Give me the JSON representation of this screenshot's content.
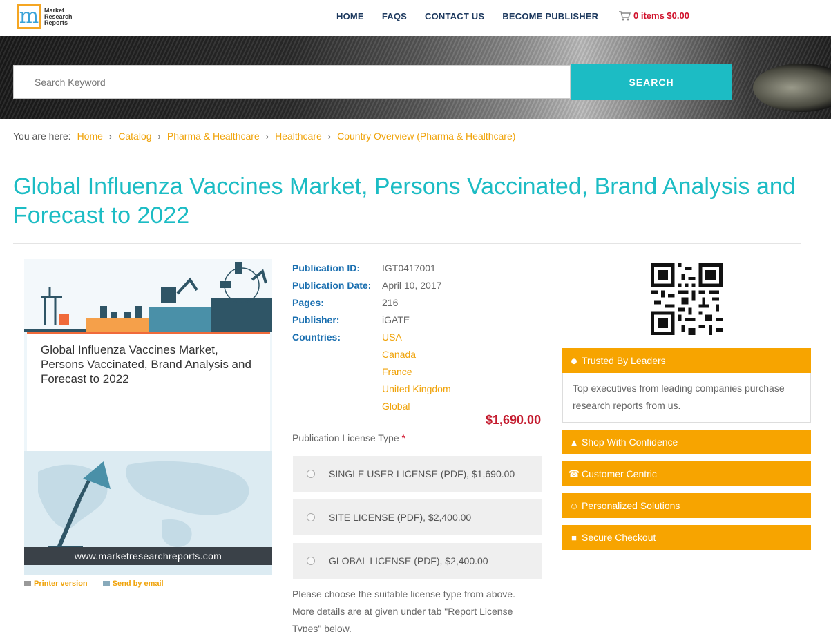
{
  "header": {
    "logo_lines": [
      "Market",
      "Research",
      "Reports"
    ],
    "nav": [
      "HOME",
      "FAQS",
      "CONTACT US",
      "BECOME PUBLISHER"
    ],
    "cart_text": "0 items $0.00"
  },
  "search": {
    "placeholder": "Search Keyword",
    "button_label": "SEARCH"
  },
  "breadcrumb": {
    "prefix": "You are here:",
    "items": [
      "Home",
      "Catalog",
      "Pharma & Healthcare",
      "Healthcare",
      "Country Overview (Pharma & Healthcare)"
    ]
  },
  "page_title": "Global Influenza Vaccines Market, Persons Vaccinated, Brand Analysis and Forecast to 2022",
  "cover": {
    "title": "Global Influenza Vaccines Market, Persons Vaccinated, Brand Analysis and Forecast to 2022",
    "url": "www.marketresearchreports.com",
    "printer_label": "Printer version",
    "email_label": "Send by email"
  },
  "meta": {
    "publication_id_label": "Publication ID:",
    "publication_id": "IGT0417001",
    "publication_date_label": "Publication Date:",
    "publication_date": "April 10, 2017",
    "pages_label": "Pages:",
    "pages": "216",
    "publisher_label": "Publisher:",
    "publisher": "iGATE",
    "countries_label": "Countries:",
    "countries": [
      "USA",
      "Canada",
      "France",
      "United Kingdom",
      "Global"
    ]
  },
  "price": "$1,690.00",
  "license": {
    "label": "Publication License Type",
    "required_mark": "*",
    "options": [
      "SINGLE USER LICENSE (PDF), $1,690.00",
      "SITE LICENSE (PDF), $2,400.00",
      "GLOBAL LICENSE (PDF), $2,400.00"
    ],
    "note": "Please choose the suitable license type from above. More details are at given under tab \"Report License Types\" below."
  },
  "sidebar": {
    "trusted_title": "Trusted By Leaders",
    "trusted_body": "Top executives from leading companies purchase research reports from us.",
    "panels": [
      "Shop With Confidence",
      "Customer Centric",
      "Personalized Solutions",
      "Secure Checkout"
    ]
  },
  "colors": {
    "accent": "#1cbcc4",
    "orange": "#f7a400",
    "link": "#f0a30a",
    "price": "#c41b2e",
    "nav": "#1e3a5f"
  }
}
